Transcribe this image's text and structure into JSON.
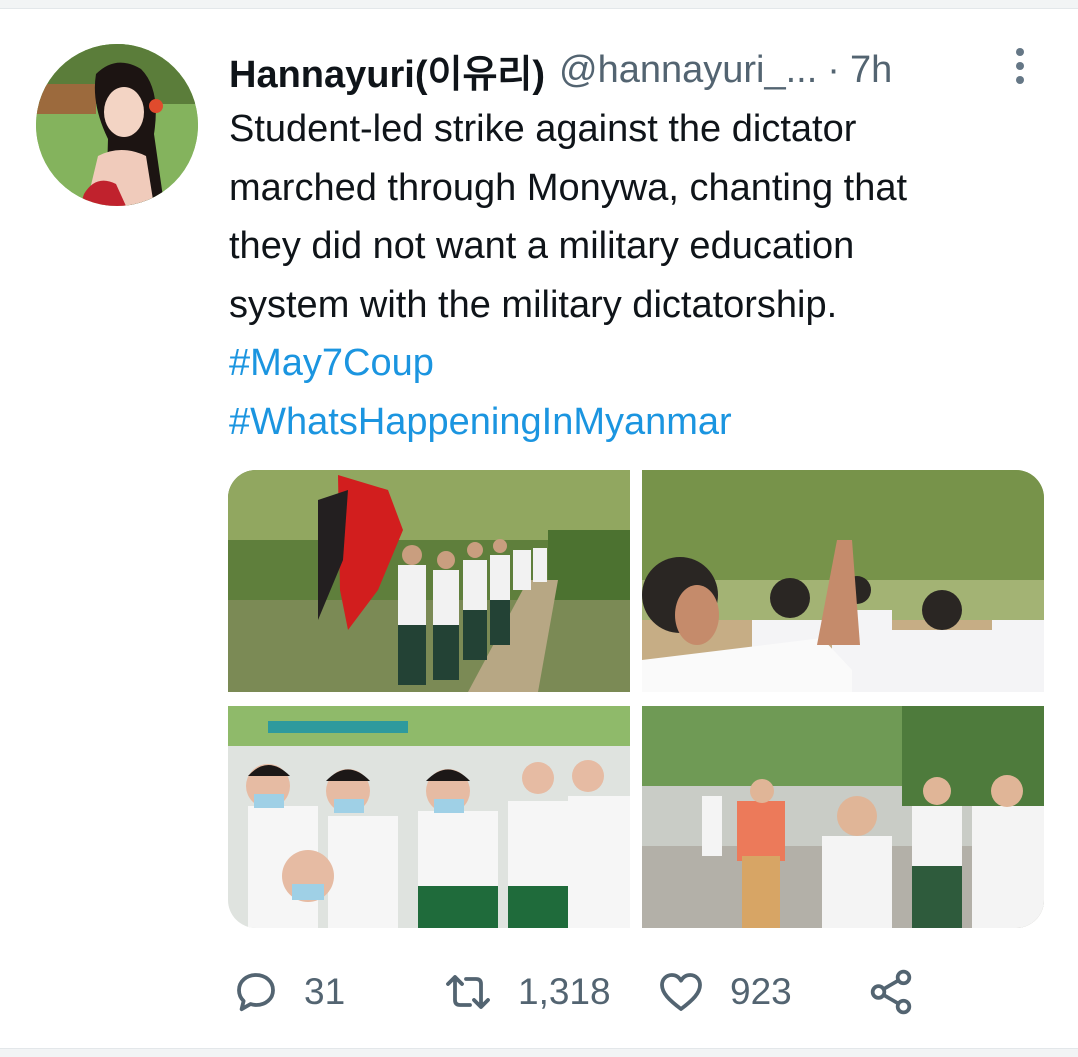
{
  "tweet": {
    "author_name": "Hannayuri(이유리)",
    "author_handle": "@hannayuri_...",
    "separator": "·",
    "time": "7h",
    "text_lines": [
      "Student-led strike against the dictator",
      "marched through Monywa, chanting that",
      "they did not want a military education",
      "system with the military dictatorship."
    ],
    "hashtags": [
      "#May7Coup",
      "#WhatsHappeningInMyanmar"
    ],
    "media": [
      {
        "icon": "photo-students-marching-with-flags"
      },
      {
        "icon": "photo-raised-three-finger-salute"
      },
      {
        "icon": "photo-masked-students-crowd"
      },
      {
        "icon": "photo-students-on-street"
      }
    ],
    "stats": {
      "replies": "31",
      "retweets": "1,318",
      "likes": "923"
    }
  },
  "icons": {
    "reply": "reply-icon",
    "retweet": "retweet-icon",
    "like": "heart-icon",
    "share": "share-icon",
    "more": "more-vertical-icon"
  },
  "colors": {
    "text": "#0f1419",
    "secondary": "#536471",
    "link": "#1b95e0",
    "background": "#ffffff"
  }
}
